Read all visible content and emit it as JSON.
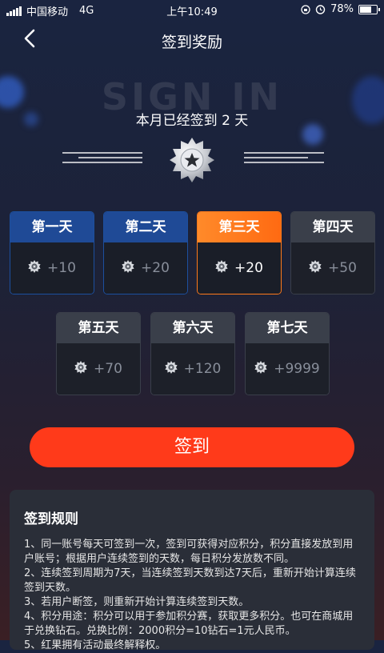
{
  "status_bar": {
    "carrier": "中国移动",
    "network": "4G",
    "time": "上午10:49",
    "battery": "78%",
    "battery_level": 0.78
  },
  "header": {
    "title": "签到奖励",
    "back_icon": "chevron-left-icon"
  },
  "banner": {
    "bg_text": "SIGN IN",
    "signed_text": "本月已经签到 2 天",
    "medal_icon": "star-medal-icon"
  },
  "days": [
    {
      "label": "第一天",
      "reward": "+10",
      "state": "signed"
    },
    {
      "label": "第二天",
      "reward": "+20",
      "state": "signed"
    },
    {
      "label": "第三天",
      "reward": "+20",
      "state": "today"
    },
    {
      "label": "第四天",
      "reward": "+50",
      "state": "future"
    },
    {
      "label": "第五天",
      "reward": "+70",
      "state": "future"
    },
    {
      "label": "第六天",
      "reward": "+120",
      "state": "future"
    },
    {
      "label": "第七天",
      "reward": "+9999",
      "state": "future"
    }
  ],
  "sign_button": {
    "label": "签到"
  },
  "rules": {
    "title": "签到规则",
    "lines": [
      "1、同一账号每天可签到一次，签到可获得对应积分，积分直接发放到用户账号；根据用户连续签到的天数，每日积分发放数不同。",
      "2、连续签到周期为7天，当连续签到天数到达7天后，重新开始计算连续签到天数。",
      "3、若用户断签，则重新开始计算连续签到天数。",
      "4、积分用途：积分可以用于参加积分赛，获取更多积分。也可在商城用于兑换钻石。兑换比例：2000积分=10钻石=1元人民币。",
      "5、红果拥有活动最终解释权。"
    ]
  },
  "colors": {
    "accent_orange": "#ff7a1a",
    "signed_blue": "#1f4a96",
    "button_red": "#ff3a1a"
  }
}
